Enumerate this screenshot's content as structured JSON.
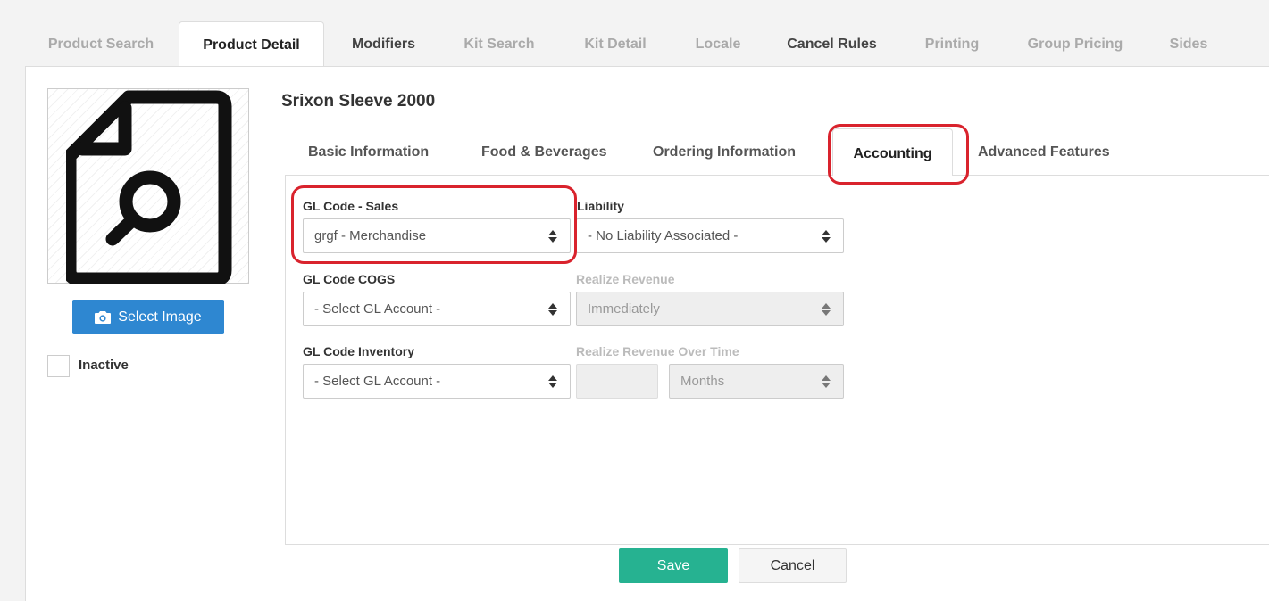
{
  "top_tabs": [
    {
      "label": "Product Search",
      "state": "inactive"
    },
    {
      "label": "Product Detail",
      "state": "active"
    },
    {
      "label": "Modifiers",
      "state": "dark"
    },
    {
      "label": "Kit Search",
      "state": "inactive"
    },
    {
      "label": "Kit Detail",
      "state": "inactive"
    },
    {
      "label": "Locale",
      "state": "inactive"
    },
    {
      "label": "Cancel Rules",
      "state": "dark"
    },
    {
      "label": "Printing",
      "state": "inactive"
    },
    {
      "label": "Group Pricing",
      "state": "inactive"
    },
    {
      "label": "Sides",
      "state": "inactive"
    }
  ],
  "sidebar": {
    "image_icon": "document-search-icon",
    "select_image_label": "Select Image",
    "camera_icon": "camera-icon",
    "inactive_label": "Inactive"
  },
  "product": {
    "title": "Srixon Sleeve 2000"
  },
  "sub_tabs": [
    {
      "label": "Basic Information"
    },
    {
      "label": "Food & Beverages"
    },
    {
      "label": "Ordering Information"
    },
    {
      "label": "Accounting",
      "active": true
    },
    {
      "label": "Advanced Features"
    }
  ],
  "form": {
    "gl_sales": {
      "label": "GL Code - Sales",
      "value": "grgf - Merchandise"
    },
    "liability": {
      "label": "Liability",
      "value": "- No Liability Associated -"
    },
    "gl_cogs": {
      "label": "GL Code COGS",
      "value": "- Select GL Account -"
    },
    "realize_revenue": {
      "label": "Realize Revenue",
      "value": "Immediately"
    },
    "gl_inventory": {
      "label": "GL Code Inventory",
      "value": "- Select GL Account -"
    },
    "realize_over_time": {
      "label": "Realize Revenue Over Time",
      "value": "",
      "unit": "Months"
    }
  },
  "actions": {
    "save_label": "Save",
    "cancel_label": "Cancel"
  },
  "colors": {
    "primary_blue": "#2e87d1",
    "save_green": "#26b291",
    "highlight_red": "#d9232d"
  }
}
